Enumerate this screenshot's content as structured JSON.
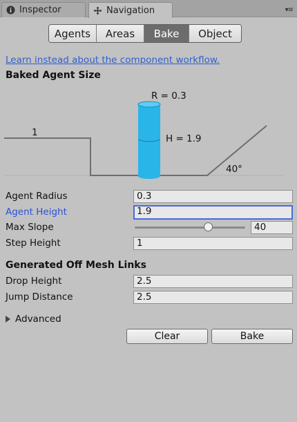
{
  "tabs": {
    "inspector": {
      "label": "Inspector",
      "icon": "info-icon"
    },
    "navigation": {
      "label": "Navigation",
      "icon": "navigation-icon"
    },
    "menu_icon": "tab-menu-icon"
  },
  "toolbar": {
    "buttons": [
      "Agents",
      "Areas",
      "Bake",
      "Object"
    ],
    "active": "Bake"
  },
  "link_text": "Learn instead about the component workflow.",
  "baked_agent_size": {
    "title": "Baked Agent Size",
    "radius_label": "R = 0.3",
    "height_label": "H = 1.9",
    "step_label": "1",
    "slope_label": "40°"
  },
  "properties": {
    "agent_radius": {
      "label": "Agent Radius",
      "value": "0.3"
    },
    "agent_height": {
      "label": "Agent Height",
      "value": "1.9"
    },
    "max_slope": {
      "label": "Max Slope",
      "value": "40",
      "slider_fraction": 0.667
    },
    "step_height": {
      "label": "Step Height",
      "value": "1"
    }
  },
  "off_mesh_links": {
    "title": "Generated Off Mesh Links",
    "drop_height": {
      "label": "Drop Height",
      "value": "2.5"
    },
    "jump_distance": {
      "label": "Jump Distance",
      "value": "2.5"
    }
  },
  "advanced": {
    "label": "Advanced"
  },
  "actions": {
    "clear": "Clear",
    "bake": "Bake"
  },
  "colors": {
    "agent_cylinder": "#29b5e8",
    "focused_label": "#2a52d6",
    "link": "#2f5fd0",
    "active_segment": "#6c6c6c"
  }
}
